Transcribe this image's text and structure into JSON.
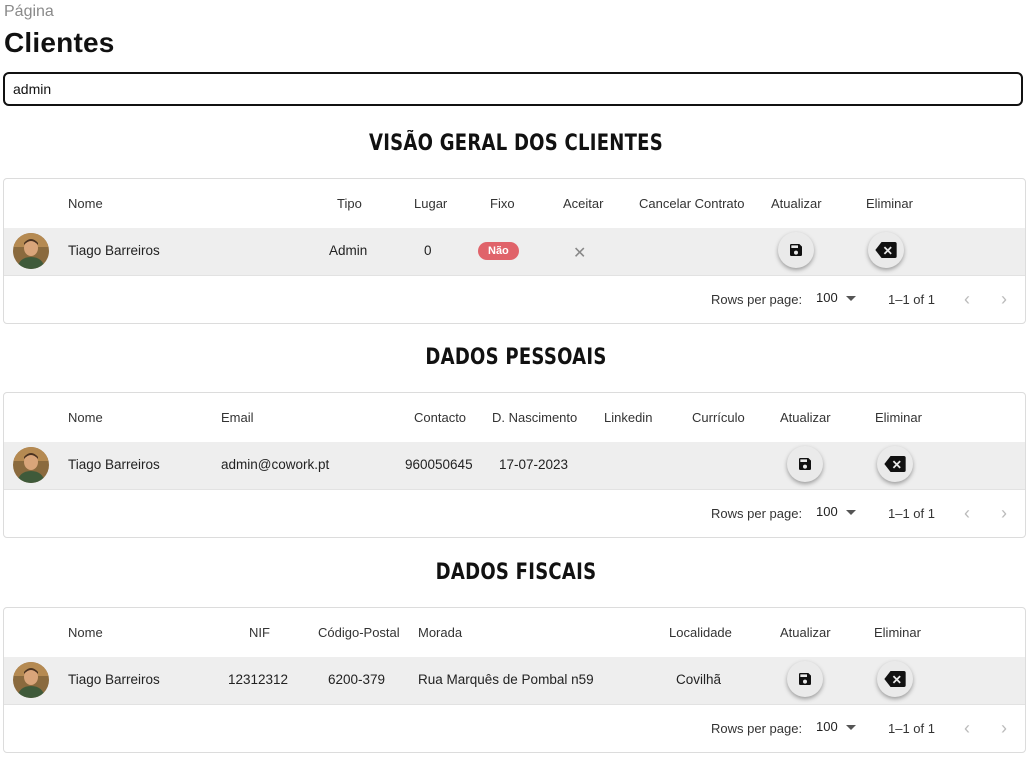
{
  "breadcrumb": "Página",
  "title": "Clientes",
  "search": {
    "value": "admin",
    "placeholder": ""
  },
  "colors": {
    "badge_no": "#e0636a",
    "row_bg": "#eeeeee"
  },
  "icons": {
    "update": "save-icon",
    "delete": "backspace-icon",
    "accept": "close-icon",
    "prev": "chevron-left-icon",
    "next": "chevron-right-icon"
  },
  "pagination": {
    "rows_per_page_label": "Rows per page:",
    "rows_per_page": "100",
    "range": "1–1 of 1"
  },
  "overview": {
    "title": "VISÃO GERAL DOS CLIENTES",
    "columns": [
      "Nome",
      "Tipo",
      "Lugar",
      "Fixo",
      "Aceitar",
      "Cancelar Contrato",
      "Atualizar",
      "Eliminar"
    ],
    "rows": [
      {
        "nome": "Tiago Barreiros",
        "tipo": "Admin",
        "lugar": "0",
        "fixo": "Não",
        "aceitar": "✕"
      }
    ]
  },
  "personal": {
    "title": "DADOS PESSOAIS",
    "columns": [
      "Nome",
      "Email",
      "Contacto",
      "D. Nascimento",
      "Linkedin",
      "Currículo",
      "Atualizar",
      "Eliminar"
    ],
    "rows": [
      {
        "nome": "Tiago Barreiros",
        "email": "admin@cowork.pt",
        "contacto": "960050645",
        "nascimento": "17-07-2023"
      }
    ]
  },
  "fiscal": {
    "title": "DADOS FISCAIS",
    "columns": [
      "Nome",
      "NIF",
      "Código-Postal",
      "Morada",
      "Localidade",
      "Atualizar",
      "Eliminar"
    ],
    "rows": [
      {
        "nome": "Tiago Barreiros",
        "nif": "12312312",
        "codigo_postal": "6200-379",
        "morada": "Rua Marquês de Pombal n59",
        "localidade": "Covilhã"
      }
    ]
  }
}
